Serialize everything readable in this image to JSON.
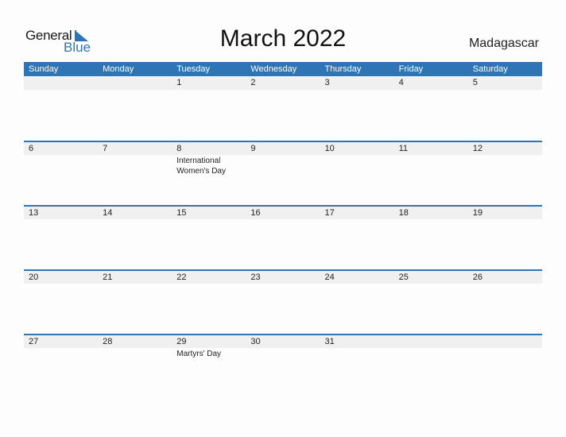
{
  "logo": {
    "line1": "General",
    "line2": "Blue"
  },
  "title": "March 2022",
  "country": "Madagascar",
  "colors": {
    "accent": "#2e75b6",
    "band": "#f0f0f0"
  },
  "weekdays": [
    "Sunday",
    "Monday",
    "Tuesday",
    "Wednesday",
    "Thursday",
    "Friday",
    "Saturday"
  ],
  "weeks": [
    [
      {
        "d": ""
      },
      {
        "d": ""
      },
      {
        "d": "1"
      },
      {
        "d": "2"
      },
      {
        "d": "3"
      },
      {
        "d": "4"
      },
      {
        "d": "5"
      }
    ],
    [
      {
        "d": "6"
      },
      {
        "d": "7"
      },
      {
        "d": "8",
        "event": "International Women's Day"
      },
      {
        "d": "9"
      },
      {
        "d": "10"
      },
      {
        "d": "11"
      },
      {
        "d": "12"
      }
    ],
    [
      {
        "d": "13"
      },
      {
        "d": "14"
      },
      {
        "d": "15"
      },
      {
        "d": "16"
      },
      {
        "d": "17"
      },
      {
        "d": "18"
      },
      {
        "d": "19"
      }
    ],
    [
      {
        "d": "20"
      },
      {
        "d": "21"
      },
      {
        "d": "22"
      },
      {
        "d": "23"
      },
      {
        "d": "24"
      },
      {
        "d": "25"
      },
      {
        "d": "26"
      }
    ],
    [
      {
        "d": "27"
      },
      {
        "d": "28"
      },
      {
        "d": "29",
        "event": "Martyrs' Day"
      },
      {
        "d": "30"
      },
      {
        "d": "31"
      },
      {
        "d": ""
      },
      {
        "d": ""
      }
    ]
  ]
}
